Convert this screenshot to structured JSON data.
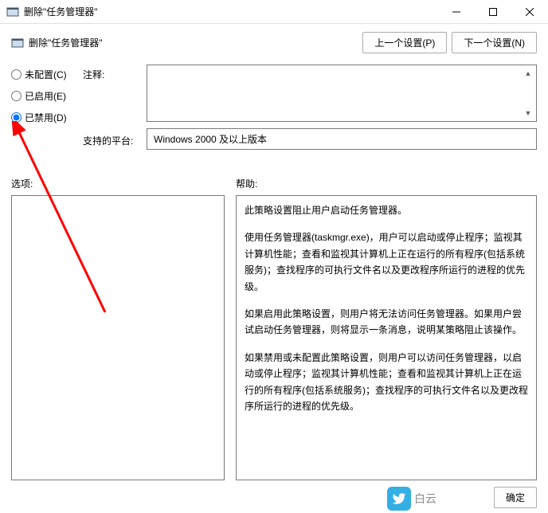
{
  "title": "删除\"任务管理器\"",
  "setting_name": "删除\"任务管理器\"",
  "nav": {
    "prev": "上一个设置(P)",
    "next": "下一个设置(N)"
  },
  "radios": {
    "not_configured": "未配置(C)",
    "enabled": "已启用(E)",
    "disabled": "已禁用(D)"
  },
  "labels": {
    "comment": "注释:",
    "supported": "支持的平台:",
    "options": "选项:",
    "help": "帮助:"
  },
  "supported_text": "Windows 2000 及以上版本",
  "help_paragraphs": [
    "此策略设置阻止用户启动任务管理器。",
    "使用任务管理器(taskmgr.exe)，用户可以启动或停止程序；监视其计算机性能；查看和监视其计算机上正在运行的所有程序(包括系统服务)；查找程序的可执行文件名以及更改程序所运行的进程的优先级。",
    "如果启用此策略设置，则用户将无法访问任务管理器。如果用户尝试启动任务管理器，则将显示一条消息，说明某策略阻止该操作。",
    "如果禁用或未配置此策略设置，则用户可以访问任务管理器，以启动或停止程序；监视其计算机性能；查看和监视其计算机上正在运行的所有程序(包括系统服务)；查找程序的可执行文件名以及更改程序所运行的进程的优先级。"
  ],
  "footer": {
    "ok": "确定"
  },
  "watermark": "白云"
}
